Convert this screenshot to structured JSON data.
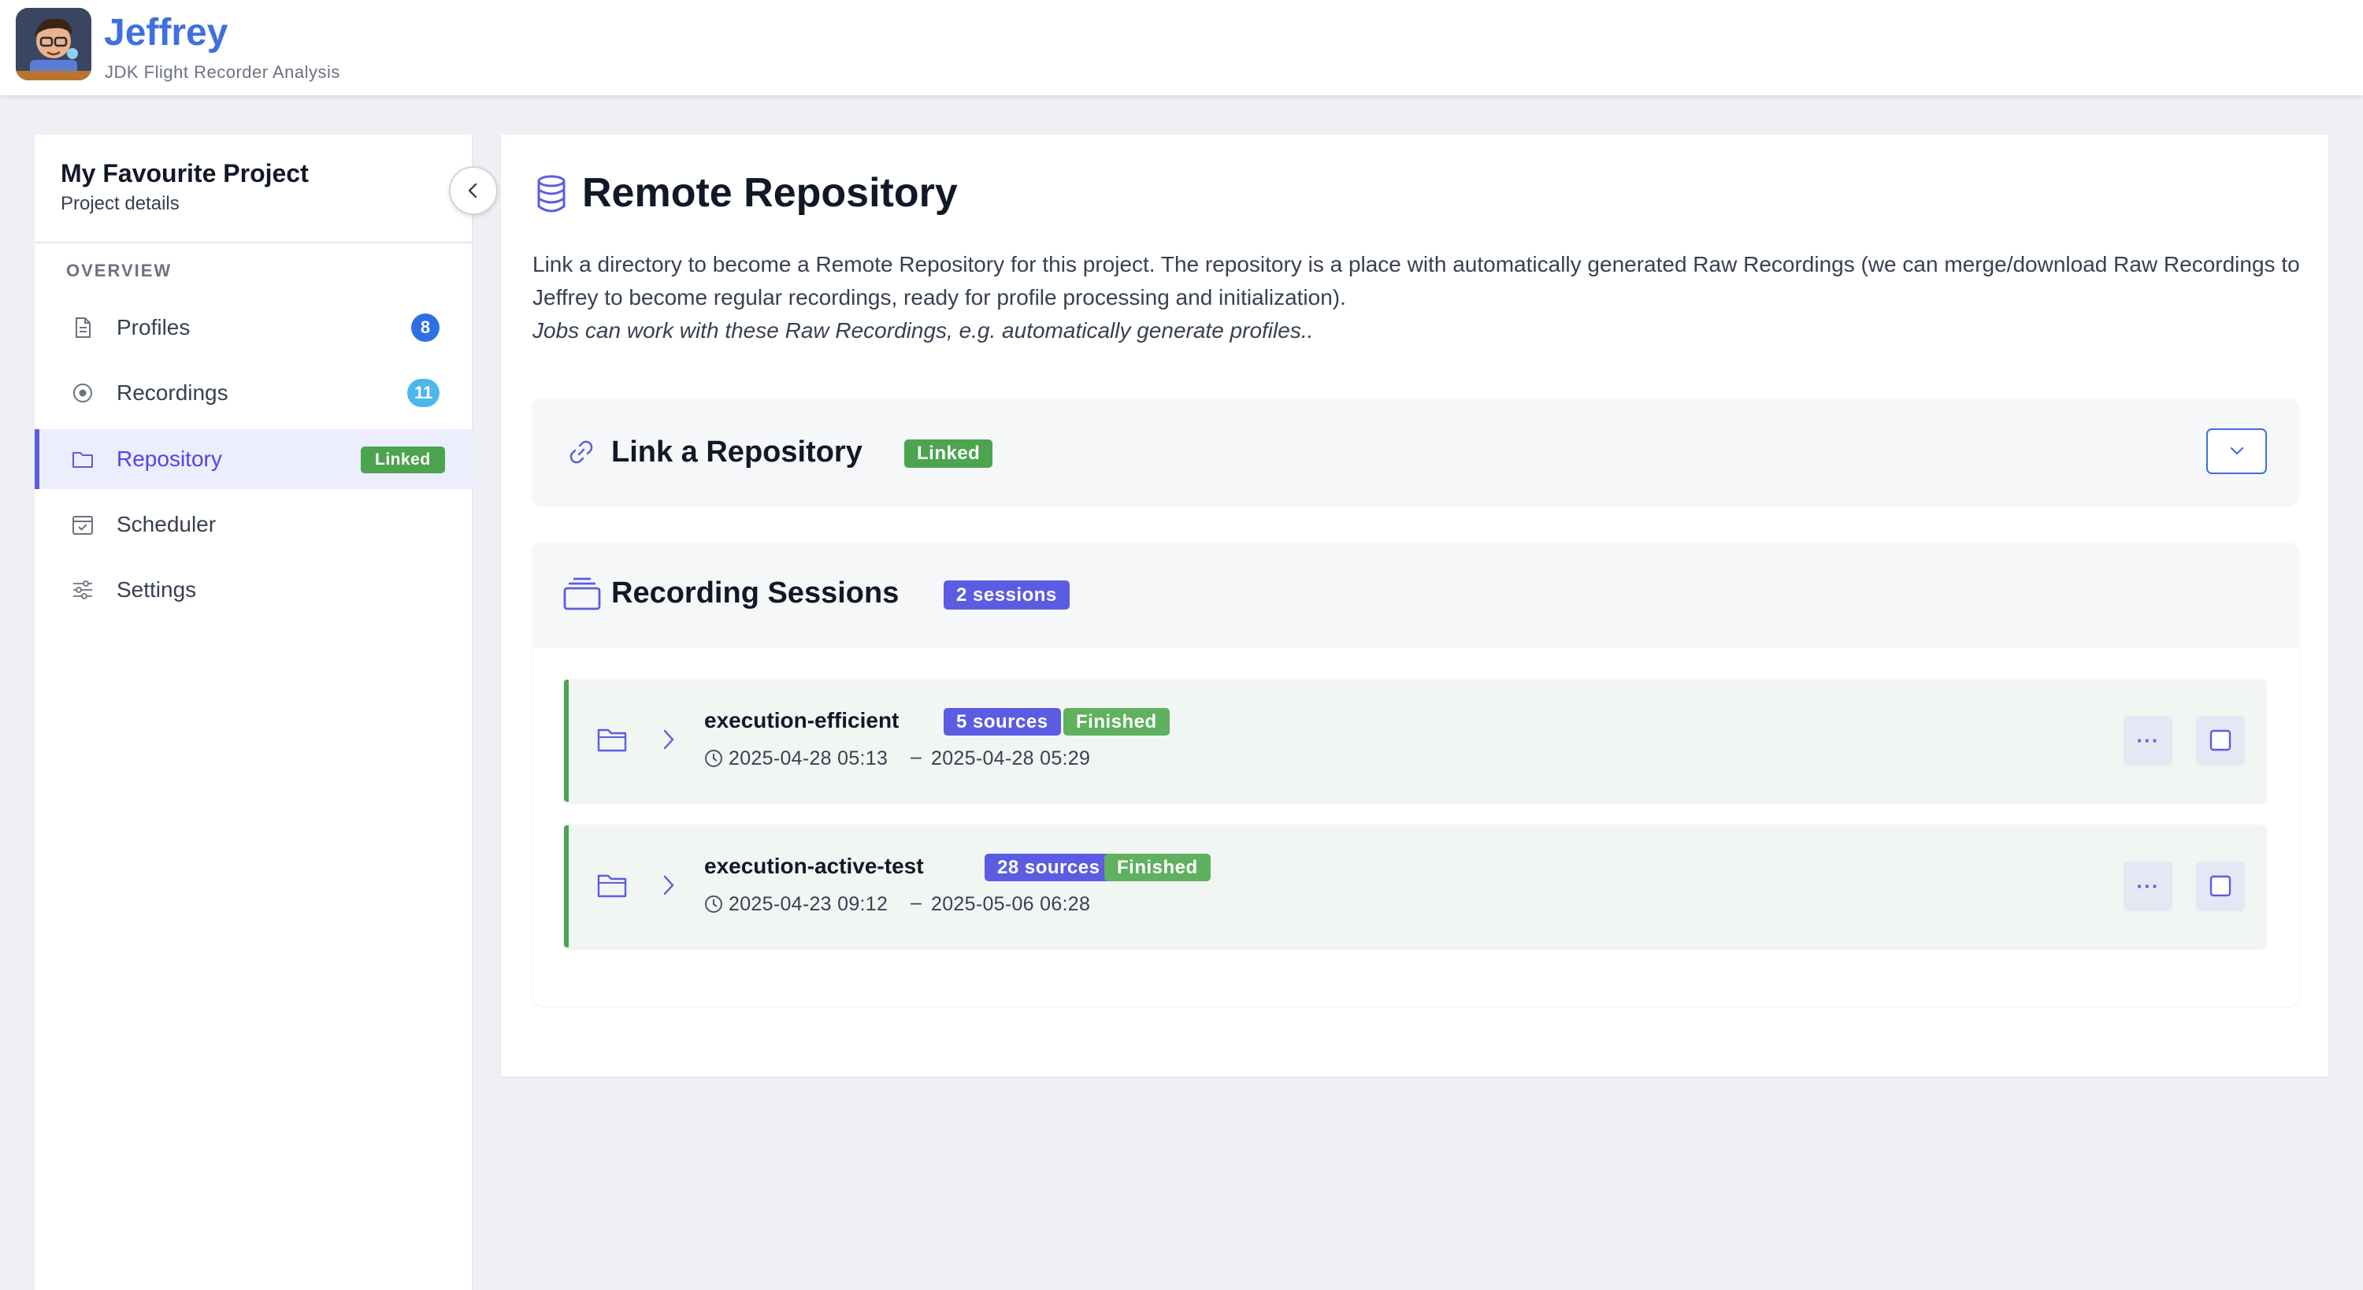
{
  "app": {
    "title": "Jeffrey",
    "subtitle": "JDK Flight Recorder Analysis"
  },
  "sidebar": {
    "project_title": "My Favourite Project",
    "project_subtitle": "Project details",
    "section_label": "OVERVIEW",
    "items": [
      {
        "label": "Profiles",
        "icon": "file-icon",
        "badge": "8",
        "badge_color": "#2f6fe4"
      },
      {
        "label": "Recordings",
        "icon": "record-icon",
        "badge": "11",
        "badge_color": "#4db8e8"
      },
      {
        "label": "Repository",
        "icon": "folder-icon",
        "badge": "Linked",
        "badge_color": "#4ca44e",
        "active": true
      },
      {
        "label": "Scheduler",
        "icon": "calendar-check-icon"
      },
      {
        "label": "Settings",
        "icon": "sliders-icon"
      }
    ]
  },
  "main": {
    "title": "Remote Repository",
    "description_line1": "Link a directory to become a Remote Repository for this project. The repository is a place with automatically generated Raw Recordings (we can merge/download Raw Recordings to Jeffrey to become regular recordings, ready for profile processing and initialization).",
    "description_line2": "Jobs can work with these Raw Recordings, e.g. automatically generate profiles..",
    "link_card": {
      "title": "Link a Repository",
      "badge": "Linked"
    },
    "sessions_card": {
      "title": "Recording Sessions",
      "badge": "2 sessions",
      "sessions": [
        {
          "name": "execution-efficient",
          "sources": "5 sources",
          "status": "Finished",
          "start": "2025-04-28 05:13",
          "end": "2025-04-28 05:29"
        },
        {
          "name": "execution-active-test",
          "sources": "28 sources",
          "status": "Finished",
          "start": "2025-04-23 09:12",
          "end": "2025-05-06 06:28"
        }
      ]
    },
    "more_label": "···",
    "range_separator": "–"
  },
  "colors": {
    "brand": "#3f6fe0",
    "accent": "#5b5ce2",
    "success": "#4ca44e"
  }
}
